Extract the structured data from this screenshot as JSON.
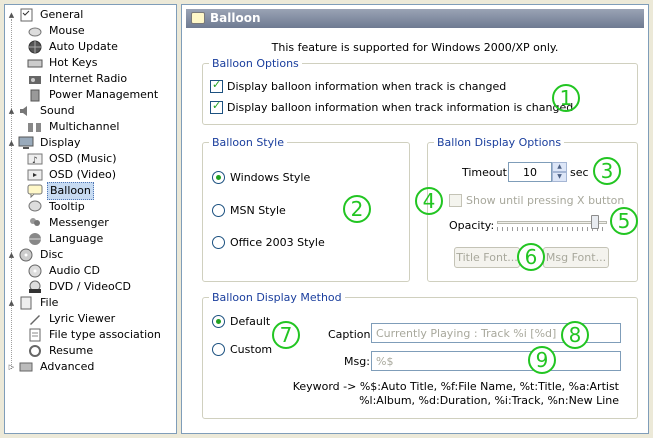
{
  "tree": {
    "items": [
      {
        "label": "General",
        "icon": "checklist-icon",
        "level": 0,
        "expander": "▲"
      },
      {
        "label": "Mouse",
        "icon": "mouse-icon",
        "level": 1
      },
      {
        "label": "Auto Update",
        "icon": "globe-icon",
        "level": 1
      },
      {
        "label": "Hot Keys",
        "icon": "keyboard-icon",
        "level": 1
      },
      {
        "label": "Internet Radio",
        "icon": "radio-icon",
        "level": 1
      },
      {
        "label": "Power Management",
        "icon": "power-icon",
        "level": 1
      },
      {
        "label": "Sound",
        "icon": "speaker-icon",
        "level": 0,
        "expander": "▲"
      },
      {
        "label": "Multichannel",
        "icon": "speakers-icon",
        "level": 1
      },
      {
        "label": "Display",
        "icon": "monitor-icon",
        "level": 0,
        "expander": "▲"
      },
      {
        "label": "OSD (Music)",
        "icon": "osd-music-icon",
        "level": 1
      },
      {
        "label": "OSD (Video)",
        "icon": "osd-video-icon",
        "level": 1
      },
      {
        "label": "Balloon",
        "icon": "balloon-icon",
        "level": 1,
        "selected": true
      },
      {
        "label": "Tooltip",
        "icon": "tooltip-icon",
        "level": 1
      },
      {
        "label": "Messenger",
        "icon": "messenger-icon",
        "level": 1
      },
      {
        "label": "Language",
        "icon": "language-icon",
        "level": 1
      },
      {
        "label": "Disc",
        "icon": "disc-icon",
        "level": 0,
        "expander": "▲"
      },
      {
        "label": "Audio CD",
        "icon": "cd-icon",
        "level": 1
      },
      {
        "label": "DVD / VideoCD",
        "icon": "dvd-icon",
        "level": 1
      },
      {
        "label": "File",
        "icon": "file-icon",
        "level": 0,
        "expander": "▲"
      },
      {
        "label": "Lyric Viewer",
        "icon": "pen-icon",
        "level": 1
      },
      {
        "label": "File type association",
        "icon": "file-assoc-icon",
        "level": 1
      },
      {
        "label": "Resume",
        "icon": "resume-icon",
        "level": 1
      },
      {
        "label": "Advanced",
        "icon": "advanced-icon",
        "level": 0,
        "expander": "▷"
      }
    ]
  },
  "panel": {
    "title": "Balloon",
    "support_note": "This feature is supported for Windows 2000/XP only."
  },
  "balloon_options": {
    "legend": "Balloon Options",
    "checkbox1": {
      "label": "Display balloon information when track is changed",
      "checked": true
    },
    "checkbox2": {
      "label": "Display balloon information when track information is changed",
      "checked": true
    }
  },
  "balloon_style": {
    "legend": "Balloon Style",
    "options": [
      {
        "label": "Windows Style",
        "selected": true
      },
      {
        "label": "MSN Style",
        "selected": false
      },
      {
        "label": "Office 2003 Style",
        "selected": false
      }
    ]
  },
  "display_options": {
    "legend": "Ballon Display Options",
    "timeout_label": "Timeout:",
    "timeout_value": "10",
    "timeout_unit": "sec",
    "show_until_label": "Show until pressing X button",
    "show_until_checked": false,
    "opacity_label": "Opacity:",
    "opacity_level": 0.92,
    "title_font_button": "Title Font...",
    "msg_font_button": "Msg Font..."
  },
  "display_method": {
    "legend": "Balloon Display Method",
    "default_label": "Default",
    "default_selected": true,
    "custom_label": "Custom",
    "custom_selected": false,
    "caption_label": "Caption:",
    "caption_placeholder": "Currently Playing : Track %i [%d]",
    "msg_label": "Msg:",
    "msg_placeholder": "%$",
    "keyword_line1": "Keyword -> %$:Auto Title, %f:File Name, %t:Title, %a:Artist",
    "keyword_line2": "%l:Album, %d:Duration, %i:Track, %n:New Line"
  },
  "callouts": [
    "1",
    "2",
    "3",
    "4",
    "5",
    "6",
    "7",
    "8",
    "9"
  ],
  "colors": {
    "callout": "#22c522",
    "header": "#7a859a",
    "legend": "#1a3e9d",
    "selection": "#c7dbf2"
  }
}
